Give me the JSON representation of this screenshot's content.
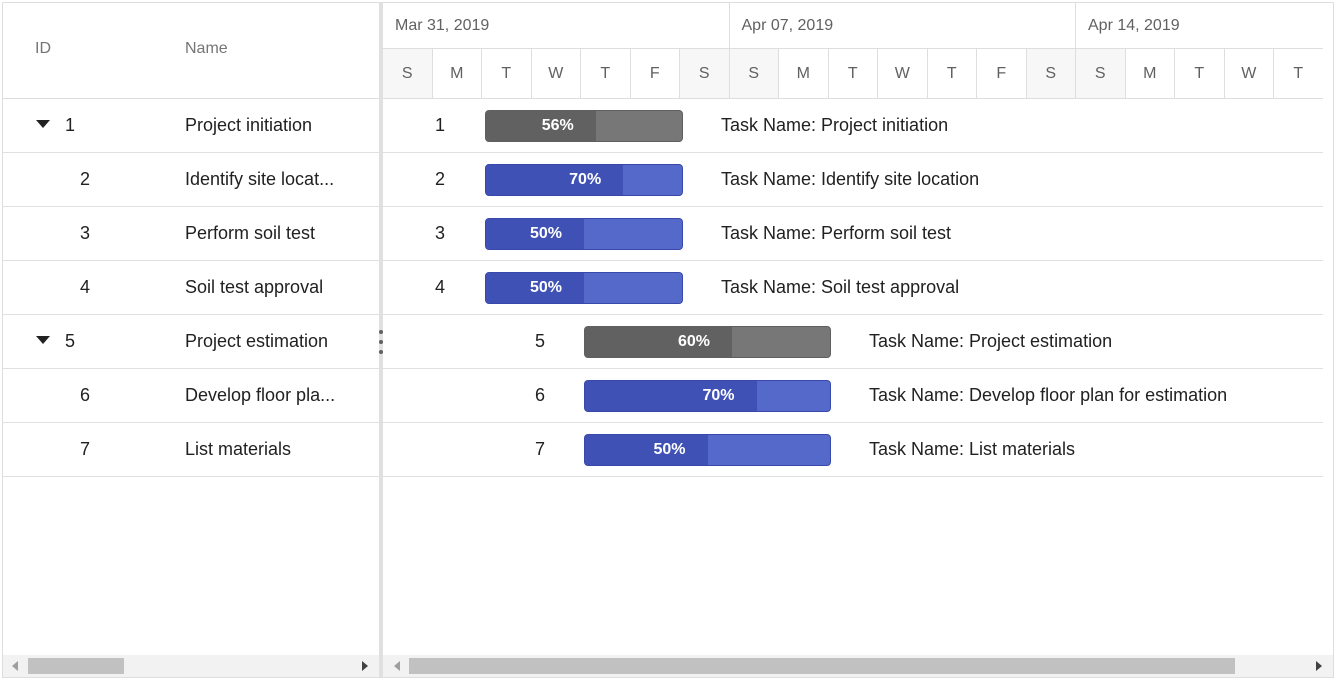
{
  "grid": {
    "headers": {
      "id": "ID",
      "name": "Name"
    },
    "rows": [
      {
        "id": "1",
        "name": "Project initiation",
        "expandable": true
      },
      {
        "id": "2",
        "name": "Identify site locat...",
        "expandable": false
      },
      {
        "id": "3",
        "name": "Perform soil test",
        "expandable": false
      },
      {
        "id": "4",
        "name": "Soil test approval",
        "expandable": false
      },
      {
        "id": "5",
        "name": "Project estimation",
        "expandable": true
      },
      {
        "id": "6",
        "name": "Develop floor pla...",
        "expandable": false
      },
      {
        "id": "7",
        "name": "List materials",
        "expandable": false
      }
    ]
  },
  "timeline": {
    "weeks": [
      "Mar 31, 2019",
      "Apr 07, 2019",
      "Apr 14, 2019"
    ],
    "days": [
      "S",
      "M",
      "T",
      "W",
      "T",
      "F",
      "S",
      "S",
      "M",
      "T",
      "W",
      "T",
      "F",
      "S",
      "S",
      "M",
      "T",
      "W",
      "T"
    ]
  },
  "tasks": [
    {
      "id": "1",
      "type": "parent",
      "progress": 0.56,
      "progress_label": "56%",
      "label": "Task Name: Project initiation"
    },
    {
      "id": "2",
      "type": "child",
      "progress": 0.7,
      "progress_label": "70%",
      "label": "Task Name: Identify site location"
    },
    {
      "id": "3",
      "type": "child",
      "progress": 0.5,
      "progress_label": "50%",
      "label": "Task Name: Perform soil test"
    },
    {
      "id": "4",
      "type": "child",
      "progress": 0.5,
      "progress_label": "50%",
      "label": "Task Name: Soil test approval"
    },
    {
      "id": "5",
      "type": "parent",
      "progress": 0.6,
      "progress_label": "60%",
      "label": "Task Name: Project estimation"
    },
    {
      "id": "6",
      "type": "child",
      "progress": 0.7,
      "progress_label": "70%",
      "label": "Task Name: Develop floor plan for estimation"
    },
    {
      "id": "7",
      "type": "child",
      "progress": 0.5,
      "progress_label": "50%",
      "label": "Task Name: List materials"
    }
  ],
  "colors": {
    "parent_bar": "#777777",
    "parent_progress": "#616161",
    "child_bar": "#5569cb",
    "child_progress": "#3f51b5"
  }
}
